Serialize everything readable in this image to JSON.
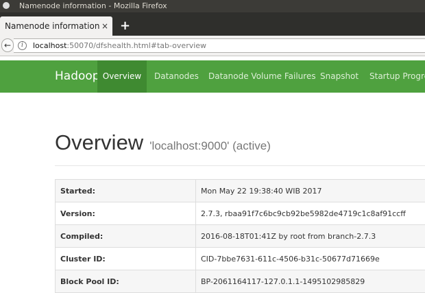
{
  "window": {
    "title": "Namenode information - Mozilla Firefox"
  },
  "browser": {
    "tab_title": "Namenode information",
    "tab_close": "×",
    "new_tab": "+",
    "back": "←",
    "url_host": "localhost",
    "url_rest": ":50070/dfshealth.html#tab-overview",
    "info_icon": "i"
  },
  "hadoop_nav": {
    "brand": "Hadoop",
    "items": [
      {
        "label": "Overview",
        "active": true
      },
      {
        "label": "Datanodes"
      },
      {
        "label": "Datanode Volume Failures"
      },
      {
        "label": "Snapshot"
      },
      {
        "label": "Startup Progress"
      }
    ]
  },
  "overview": {
    "title": "Overview",
    "subtitle": "'localhost:9000' (active)"
  },
  "info_table": [
    {
      "key": "Started:",
      "value": "Mon May 22 19:38:40 WIB 2017"
    },
    {
      "key": "Version:",
      "value": "2.7.3, rbaa91f7c6bc9cb92be5982de4719c1c8af91ccff"
    },
    {
      "key": "Compiled:",
      "value": "2016-08-18T01:41Z by root from branch-2.7.3"
    },
    {
      "key": "Cluster ID:",
      "value": "CID-7bbe7631-611c-4506-b31c-50677d71669e"
    },
    {
      "key": "Block Pool ID:",
      "value": "BP-2061164117-127.0.1.1-1495102985829"
    }
  ],
  "colors": {
    "hadoop_green": "#4fa13f",
    "active_tab": "#3f8a31"
  }
}
